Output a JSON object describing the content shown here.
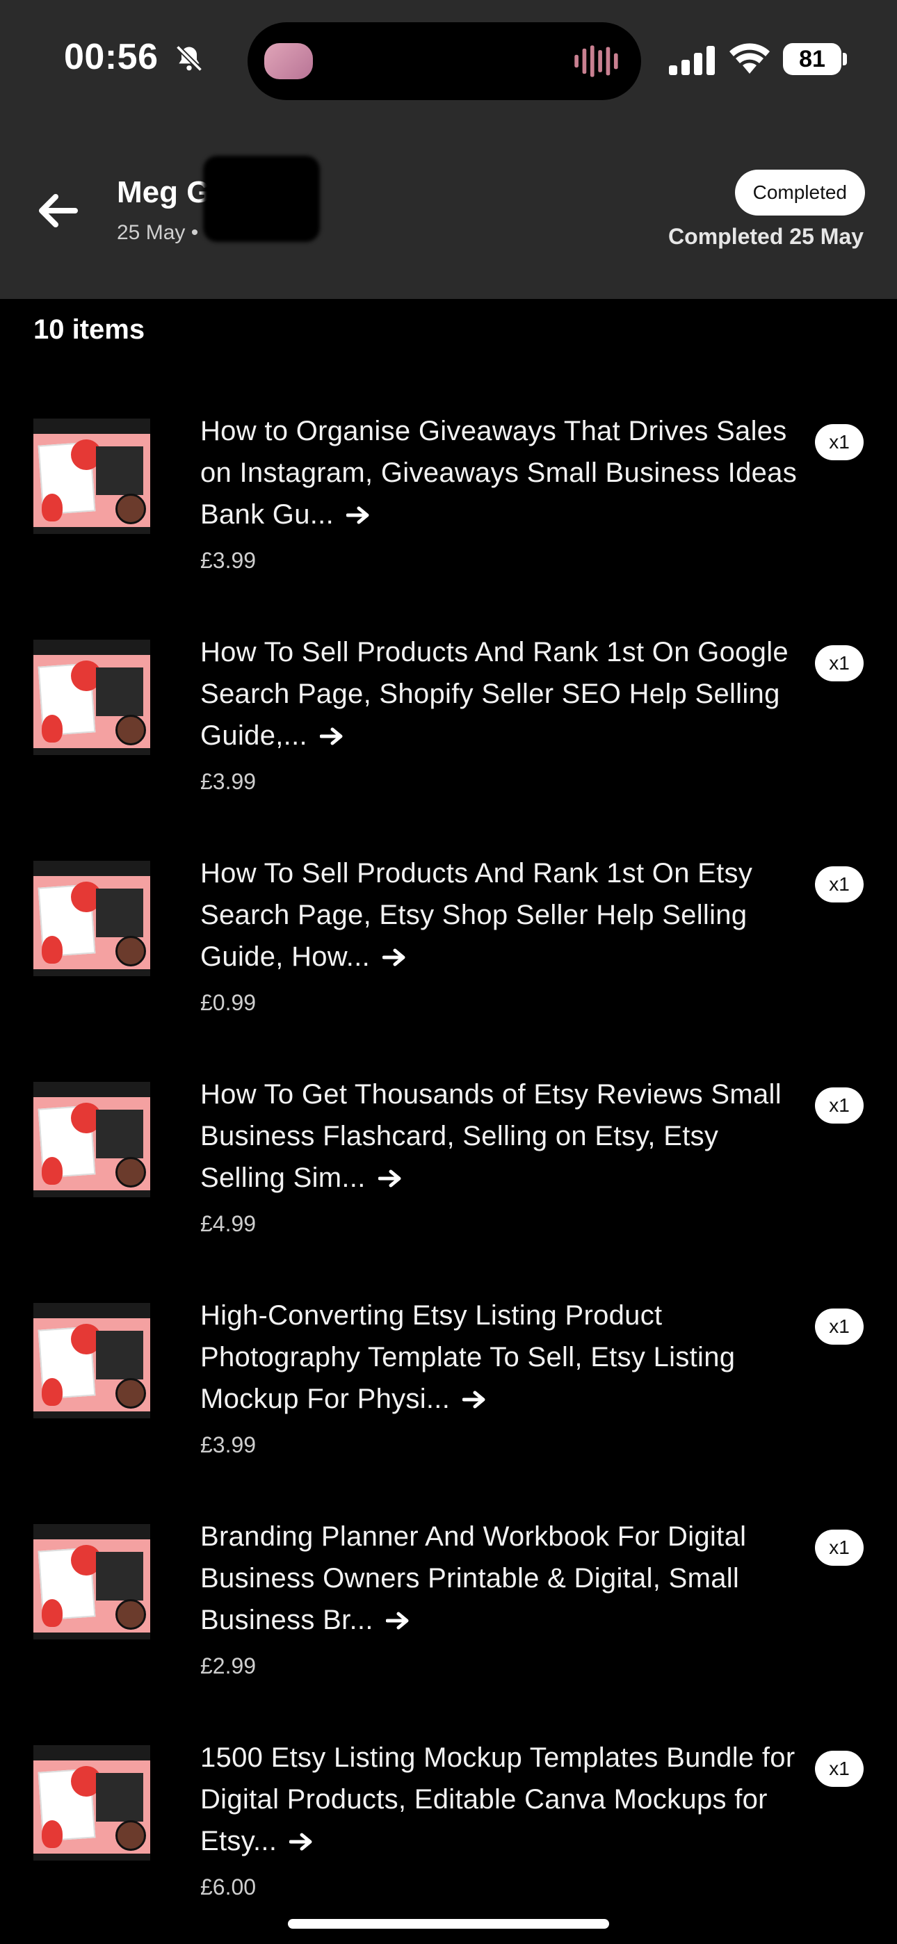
{
  "status_bar": {
    "time": "00:56",
    "battery": "81"
  },
  "header": {
    "customer_name": "Meg G",
    "order_date": "25 May •",
    "status_pill": "Completed",
    "completed_text": "Completed 25 May"
  },
  "items_count": "10 items",
  "items": [
    {
      "title": "How to Organise Giveaways That Drives Sales on Instagram, Giveaways Small Business Ideas Bank Gu...",
      "price": "£3.99",
      "qty": "x1"
    },
    {
      "title": "How To Sell Products And Rank 1st On Google Search Page, Shopify Seller SEO Help Selling Guide,...",
      "price": "£3.99",
      "qty": "x1"
    },
    {
      "title": "How To Sell Products And Rank 1st On Etsy Search Page, Etsy Shop Seller Help Selling Guide, How...",
      "price": "£0.99",
      "qty": "x1"
    },
    {
      "title": "How To Get Thousands of Etsy Reviews Small Business Flashcard, Selling on Etsy, Etsy Selling Sim...",
      "price": "£4.99",
      "qty": "x1"
    },
    {
      "title": "High-Converting Etsy Listing Product Photography Template To Sell, Etsy Listing Mockup For Physi...",
      "price": "£3.99",
      "qty": "x1"
    },
    {
      "title": "Branding Planner And Workbook For Digital Business Owners Printable & Digital, Small Business Br...",
      "price": "£2.99",
      "qty": "x1"
    },
    {
      "title": "1500 Etsy Listing Mockup Templates Bundle for Digital Products, Editable Canva Mockups for Etsy...",
      "price": "£6.00",
      "qty": "x1"
    }
  ]
}
